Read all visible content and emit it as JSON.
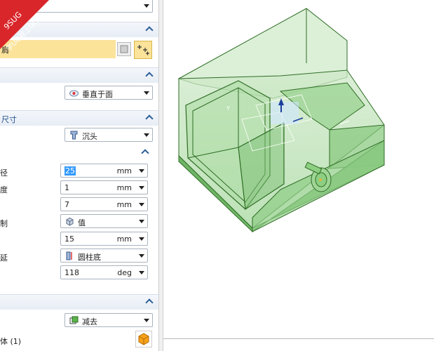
{
  "panel": {
    "sections": {
      "s1_label": "",
      "s2_label": "",
      "s3_label": "尺寸",
      "s4_label": "",
      "s5_label": ""
    },
    "top_dropdown_text": "",
    "selection_text": "肩",
    "direction": {
      "value": "垂直于面"
    },
    "form": {
      "value": "沉头"
    },
    "fields": [
      {
        "label": "径",
        "value": "25",
        "unit": "mm",
        "selected": true
      },
      {
        "label": "度",
        "value": "1",
        "unit": "mm"
      },
      {
        "label": "",
        "value": "7",
        "unit": "mm"
      },
      {
        "label": "制",
        "value": "值",
        "unit": ""
      },
      {
        "label": "",
        "value": "15",
        "unit": "mm"
      },
      {
        "label": "延",
        "value": "圆柱底",
        "unit": ""
      },
      {
        "label": "",
        "value": "118",
        "unit": "deg"
      }
    ],
    "boolean": {
      "value": "减去"
    },
    "body_label": "体 (1)"
  },
  "watermark": {
    "line1": "9SUG",
    "line2": "学UG就上UG网"
  },
  "colors": {
    "accent": "#1f4e8c",
    "highlight": "#fbe39a",
    "model": "#7fd07a",
    "selection": "#3399ff"
  }
}
